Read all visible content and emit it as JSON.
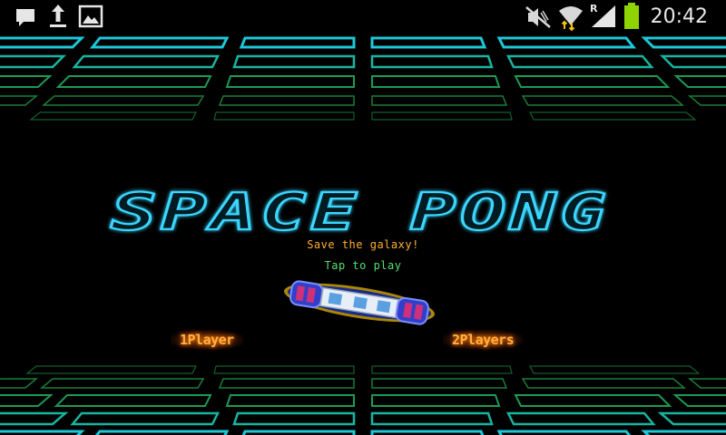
{
  "status_bar": {
    "time": "20:42",
    "roaming": "R",
    "left_icons": [
      "chat-notification-icon",
      "upload-icon",
      "image-icon"
    ],
    "right_icons": [
      "mute-icon",
      "wifi-icon",
      "signal-icon",
      "battery-icon"
    ],
    "battery_color": "#8fd400"
  },
  "game": {
    "title": "SPACE PONG",
    "tagline": "Save the galaxy!",
    "tap_prompt": "Tap to play",
    "buttons": {
      "one_player": "1Player",
      "two_players": "2Players"
    },
    "colors": {
      "grid_near": "#1ec8d8",
      "grid_far": "#1f9a3a",
      "title_outline": "#3ad6ff",
      "tagline": "#ffb030",
      "tap_prompt": "#55e070",
      "button_text": "#ffb040"
    }
  }
}
